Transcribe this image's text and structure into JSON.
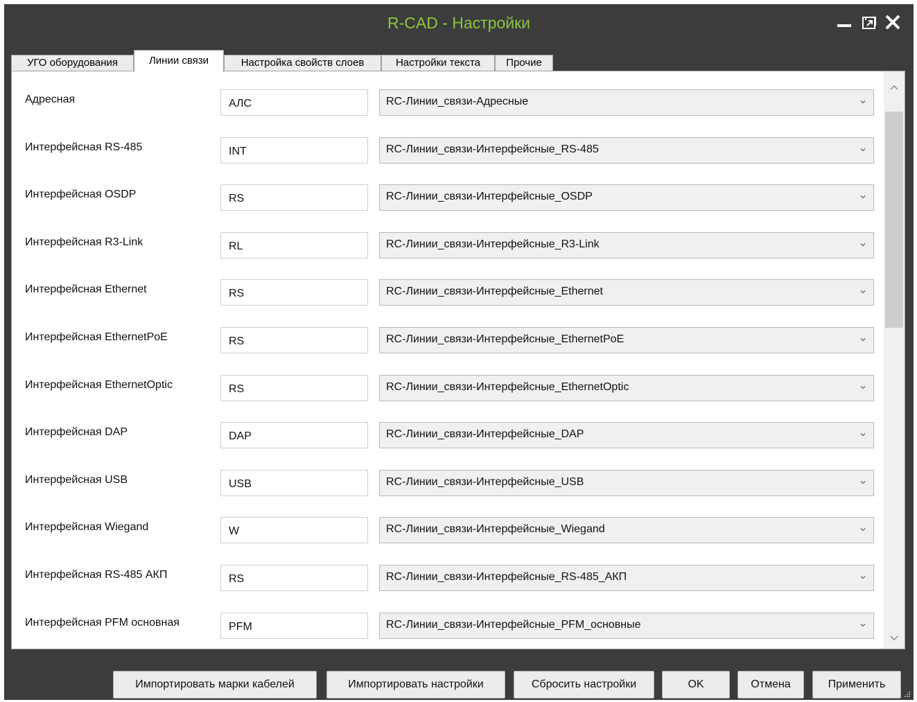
{
  "window": {
    "title": "R-CAD - Настройки",
    "title_color": "#8cc63f",
    "background": "#3c3c3c"
  },
  "tabs": [
    {
      "label": "УГО оборудования",
      "active": false
    },
    {
      "label": "Линии связи",
      "active": true
    },
    {
      "label": "Настройка свойств слоев",
      "active": false
    },
    {
      "label": "Настройки текста",
      "active": false
    },
    {
      "label": "Прочие",
      "active": false
    }
  ],
  "rows": [
    {
      "label": "Адресная",
      "code": "АЛС",
      "layer": "RC-Линии_связи-Адресные"
    },
    {
      "label": "Интерфейсная RS-485",
      "code": "INT",
      "layer": "RC-Линии_связи-Интерфейсные_RS-485"
    },
    {
      "label": "Интерфейсная OSDP",
      "code": "RS",
      "layer": "RC-Линии_связи-Интерфейсные_OSDP"
    },
    {
      "label": "Интерфейсная R3-Link",
      "code": "RL",
      "layer": "RC-Линии_связи-Интерфейсные_R3-Link"
    },
    {
      "label": "Интерфейсная Ethernet",
      "code": "RS",
      "layer": "RC-Линии_связи-Интерфейсные_Ethernet"
    },
    {
      "label": "Интерфейсная EthernetPoE",
      "code": "RS",
      "layer": "RC-Линии_связи-Интерфейсные_EthernetPoE"
    },
    {
      "label": "Интерфейсная EthernetOptic",
      "code": "RS",
      "layer": "RC-Линии_связи-Интерфейсные_EthernetOptic"
    },
    {
      "label": "Интерфейсная DAP",
      "code": "DAP",
      "layer": "RC-Линии_связи-Интерфейсные_DAP"
    },
    {
      "label": "Интерфейсная USB",
      "code": "USB",
      "layer": "RC-Линии_связи-Интерфейсные_USB"
    },
    {
      "label": "Интерфейсная Wiegand",
      "code": "W",
      "layer": "RC-Линии_связи-Интерфейсные_Wiegand"
    },
    {
      "label": "Интерфейсная RS-485 АКП",
      "code": "RS",
      "layer": "RC-Линии_связи-Интерфейсные_RS-485_АКП"
    },
    {
      "label": "Интерфейсная PFM основная",
      "code": "PFM",
      "layer": "RC-Линии_связи-Интерфейсные_PFM_основные"
    }
  ],
  "buttons": {
    "import_cable_marks": "Импортировать марки кабелей",
    "import_settings": "Импортировать настройки",
    "reset_settings": "Сбросить настройки",
    "ok": "OK",
    "cancel": "Отмена",
    "apply": "Применить"
  }
}
